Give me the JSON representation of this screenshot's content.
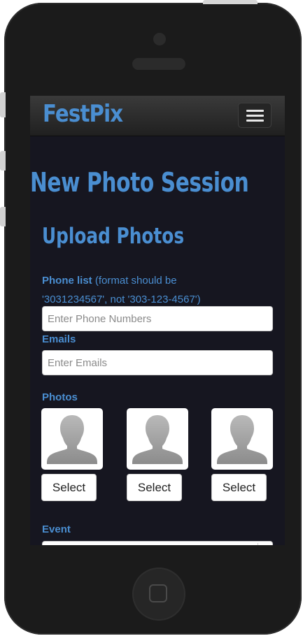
{
  "navbar": {
    "brand": "FestPix",
    "menu_icon": "hamburger-menu-icon"
  },
  "page": {
    "title": "New Photo Session",
    "section_title": "Upload Photos"
  },
  "form": {
    "phone": {
      "label": "Phone list",
      "hint_line1": " (format should be",
      "hint_line2": "'3031234567', not '303-123-4567')",
      "placeholder": "Enter Phone Numbers"
    },
    "emails": {
      "label": "Emails",
      "placeholder": "Enter Emails"
    },
    "photos": {
      "label": "Photos",
      "placeholder_icon": "person-silhouette-icon",
      "slots": [
        {
          "button_label": "Select"
        },
        {
          "button_label": "Select"
        },
        {
          "button_label": "Select"
        }
      ]
    },
    "event": {
      "label": "Event"
    }
  },
  "colors": {
    "accent": "#4a8ed1",
    "screen_background": "#161620",
    "navbar": "#2a2a2a",
    "device": "#1b1b1b"
  }
}
